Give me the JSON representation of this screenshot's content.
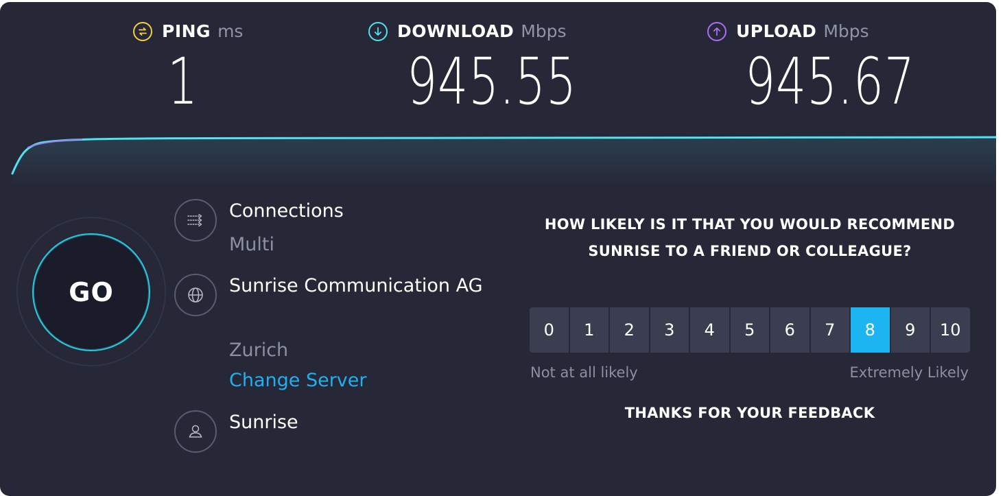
{
  "metrics": {
    "ping": {
      "label": "PING",
      "unit": "ms",
      "value": "1",
      "icon": "ping-icon",
      "color": "#f4d03f"
    },
    "download": {
      "label": "DOWNLOAD",
      "unit": "Mbps",
      "value": "945.55",
      "icon": "download-arrow-icon",
      "color": "#4fe3ee"
    },
    "upload": {
      "label": "UPLOAD",
      "unit": "Mbps",
      "value": "945.67",
      "icon": "upload-arrow-icon",
      "color": "#b06cf5"
    }
  },
  "go_button": {
    "label": "GO",
    "accent": "#27c9d8"
  },
  "connections": {
    "title": "Connections",
    "value": "Multi",
    "icon": "connections-icon"
  },
  "server": {
    "title": "Sunrise Communication AG",
    "location": "Zurich",
    "change_label": "Change Server",
    "icon": "globe-icon"
  },
  "provider": {
    "name": "Sunrise",
    "icon": "user-icon"
  },
  "survey": {
    "question": "HOW LIKELY IS IT THAT YOU WOULD RECOMMEND SUNRISE TO A FRIEND OR COLLEAGUE?",
    "options": [
      "0",
      "1",
      "2",
      "3",
      "4",
      "5",
      "6",
      "7",
      "8",
      "9",
      "10"
    ],
    "selected": "8",
    "low_label": "Not at all likely",
    "high_label": "Extremely Likely",
    "thanks": "THANKS FOR YOUR FEEDBACK",
    "selected_color": "#1cb5f2"
  }
}
